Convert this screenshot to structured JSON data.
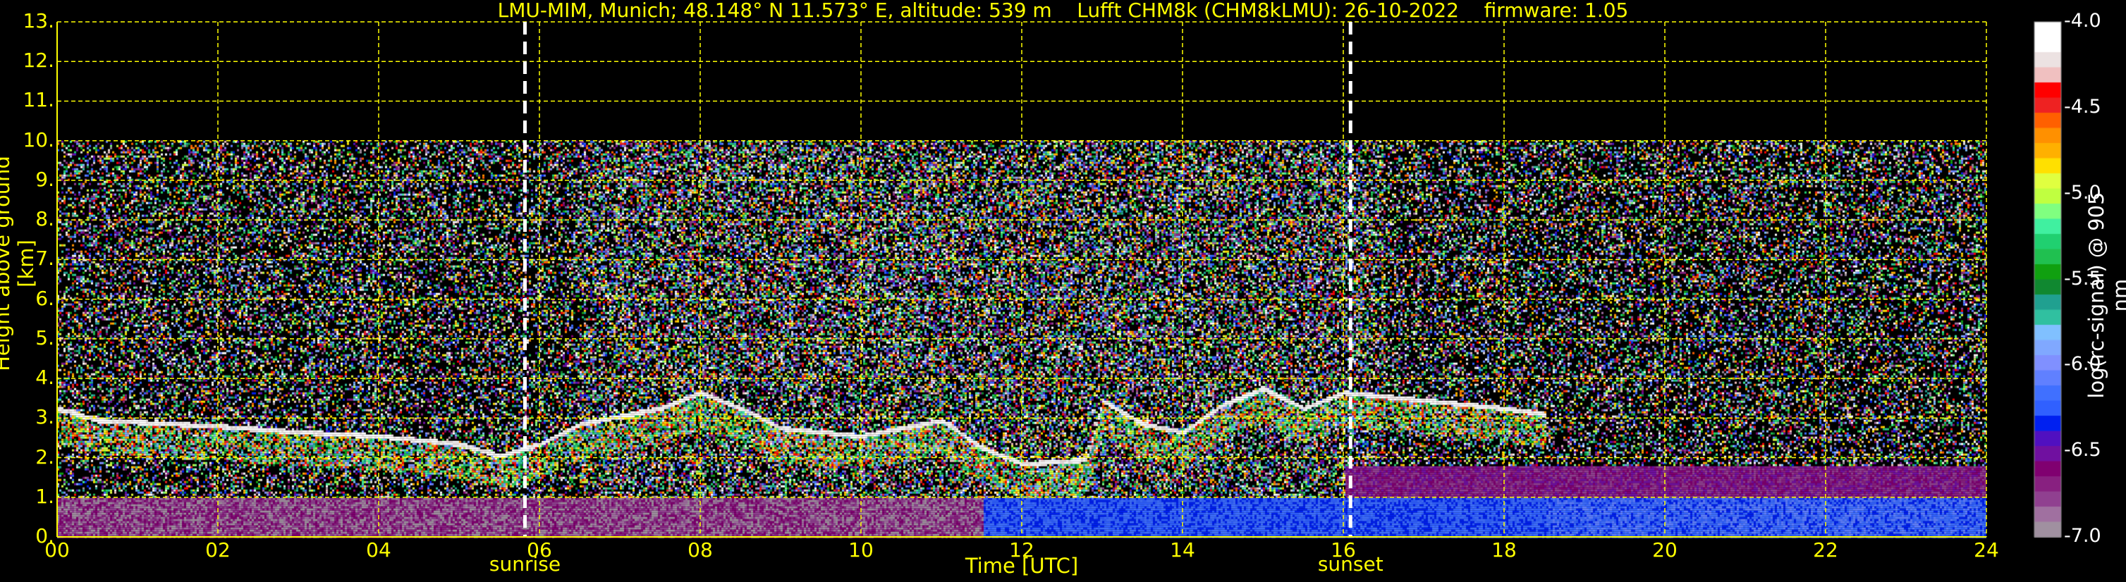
{
  "chart_data": {
    "type": "heatmap",
    "title": "LMU-MIM, Munich; 48.148° N 11.573° E, altitude: 539 m    Lufft CHM8k (CHM8kLMU): 26-10-2022    firmware: 1.05",
    "xlabel": "Time [UTC]",
    "ylabel": "Height above ground [km]",
    "xlim": [
      0,
      24
    ],
    "ylim": [
      0,
      13
    ],
    "x_ticks": [
      "00",
      "02",
      "04",
      "06",
      "08",
      "10",
      "12",
      "14",
      "16",
      "18",
      "20",
      "22",
      "24"
    ],
    "y_ticks": [
      "0.",
      "1.",
      "2.",
      "3.",
      "4.",
      "5.",
      "6.",
      "7.",
      "8.",
      "9.",
      "10.",
      "11.",
      "12.",
      "13."
    ],
    "grid": true,
    "data_top_km": 10,
    "annotations": [
      {
        "label": "sunrise",
        "time_h": 5.82
      },
      {
        "label": "sunset",
        "time_h": 16.09
      }
    ],
    "colorbar": {
      "label": "log(rc-signal) @ 905 nm",
      "range": [
        -7.0,
        -4.0
      ],
      "ticks": [
        "-4.0",
        "-4.5",
        "-5.0",
        "-5.5",
        "-6.0",
        "-6.5",
        "-7.0"
      ],
      "colors": [
        "#ffffff",
        "#ffffff",
        "#ece2e2",
        "#f0c0c0",
        "#ff0000",
        "#ee2222",
        "#ff6000",
        "#ff9000",
        "#ffb000",
        "#ffe000",
        "#e0ff40",
        "#c0ff40",
        "#80ff80",
        "#40f0a0",
        "#20d070",
        "#20c050",
        "#10a010",
        "#108830",
        "#20a090",
        "#30c0a0",
        "#80c0ff",
        "#80a8ff",
        "#8090ff",
        "#6080ff",
        "#4070ff",
        "#3060ff",
        "#0020f0",
        "#5010c0",
        "#7010a0",
        "#800070",
        "#882080",
        "#904090",
        "#a070a0",
        "#a090a0"
      ]
    },
    "cloud_base_km": {
      "time_h": [
        0,
        0.5,
        1,
        2,
        3,
        4,
        5,
        5.5,
        6,
        6.5,
        7,
        7.5,
        8,
        8.5,
        9,
        10,
        11,
        11.5,
        12,
        12.8,
        13,
        13.5,
        14,
        14.5,
        15,
        15.5,
        16,
        17,
        18,
        18.5
      ],
      "height": [
        3.2,
        2.9,
        2.85,
        2.75,
        2.6,
        2.5,
        2.3,
        2.0,
        2.3,
        2.8,
        3.0,
        3.2,
        3.6,
        3.2,
        2.7,
        2.5,
        2.9,
        2.2,
        1.8,
        1.9,
        3.4,
        2.8,
        2.6,
        3.3,
        3.7,
        3.2,
        3.6,
        3.4,
        3.2,
        3.05
      ]
    }
  }
}
